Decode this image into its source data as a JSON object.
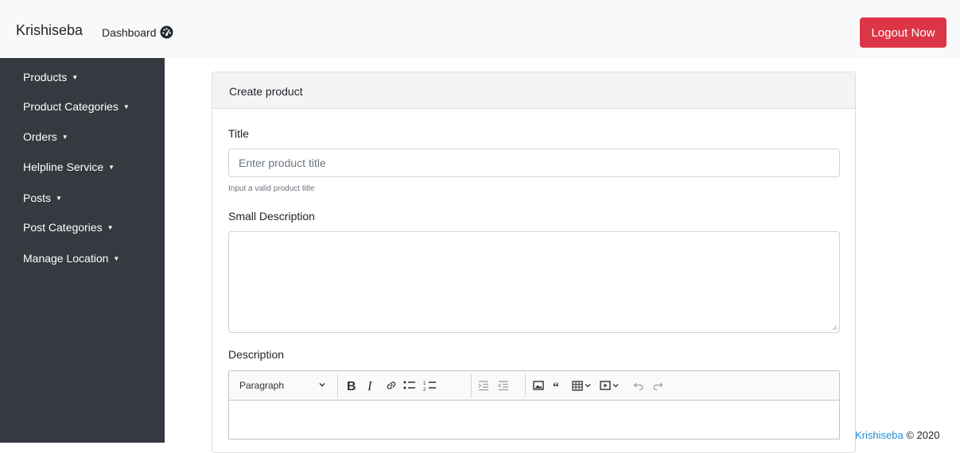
{
  "header": {
    "brand": "Krishiseba",
    "dashboard_label": "Dashboard",
    "dashboard_icon": "tachometer-icon",
    "logout_label": "Logout Now"
  },
  "sidebar": {
    "items": [
      {
        "label": "Products"
      },
      {
        "label": "Product Categories"
      },
      {
        "label": "Orders"
      },
      {
        "label": "Helpline Service"
      },
      {
        "label": "Posts"
      },
      {
        "label": "Post Categories"
      },
      {
        "label": "Manage Location"
      }
    ]
  },
  "form": {
    "card_title": "Create product",
    "title_label": "Title",
    "title_placeholder": "Enter product title",
    "title_help": "Input a valid product title",
    "small_desc_label": "Small Description",
    "desc_label": "Description",
    "editor": {
      "heading_select": "Paragraph",
      "buttons": [
        "bold-icon",
        "italic-icon",
        "link-icon",
        "bulleted-list-icon",
        "numbered-list-icon",
        "indent-icon",
        "outdent-icon",
        "image-icon",
        "quote-icon",
        "table-icon",
        "media-icon",
        "undo-icon",
        "redo-icon"
      ]
    }
  },
  "footer": {
    "brand_link": "Krishiseba",
    "copyright": "© 2020"
  },
  "colors": {
    "sidebar_bg": "#343a40",
    "logout_bg": "#dc3545",
    "footer_link": "#1e8ed6"
  }
}
